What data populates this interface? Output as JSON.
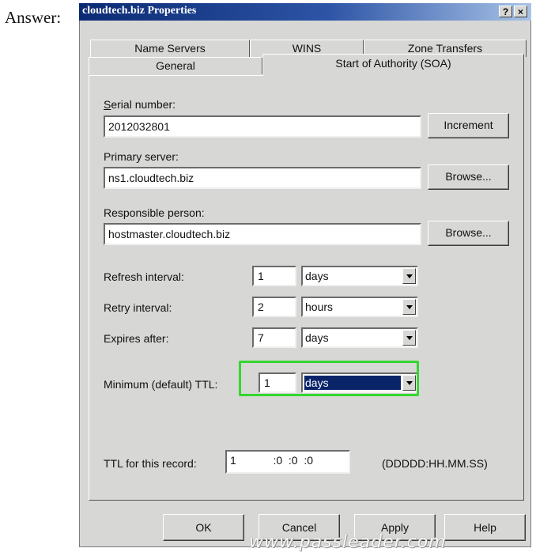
{
  "answer_label": "Answer:",
  "window": {
    "title": "cloudtech.biz Properties",
    "help_button": "?",
    "close_button": "×"
  },
  "tabs": {
    "back": [
      "Name Servers",
      "WINS",
      "Zone Transfers"
    ],
    "front": [
      "General",
      "Start of Authority (SOA)"
    ],
    "active": "Start of Authority (SOA)"
  },
  "serial": {
    "label": "Serial number:",
    "value": "2012032801",
    "button": "Increment"
  },
  "primary": {
    "label": "Primary server:",
    "value": "ns1.cloudtech.biz",
    "button": "Browse..."
  },
  "responsible": {
    "label": "Responsible person:",
    "value": "hostmaster.cloudtech.biz",
    "button": "Browse..."
  },
  "refresh": {
    "label": "Refresh interval:",
    "value": "1",
    "unit": "days"
  },
  "retry": {
    "label": "Retry interval:",
    "value": "2",
    "unit": "hours"
  },
  "expires": {
    "label": "Expires after:",
    "value": "7",
    "unit": "days"
  },
  "min_ttl": {
    "label": "Minimum (default) TTL:",
    "value": "1",
    "unit": "days"
  },
  "ttl": {
    "label": "TTL for this record:",
    "value": "1            :0  :0  :0",
    "format": "(DDDDD:HH.MM.SS)"
  },
  "footer": {
    "ok": "OK",
    "cancel": "Cancel",
    "apply": "Apply",
    "help": "Help"
  },
  "watermark": "www.passleader.com",
  "colors": {
    "title_start": "#0b2a73",
    "selection": "#0a246a",
    "highlight": "#35d62f",
    "dialog": "#d7d7d5"
  }
}
